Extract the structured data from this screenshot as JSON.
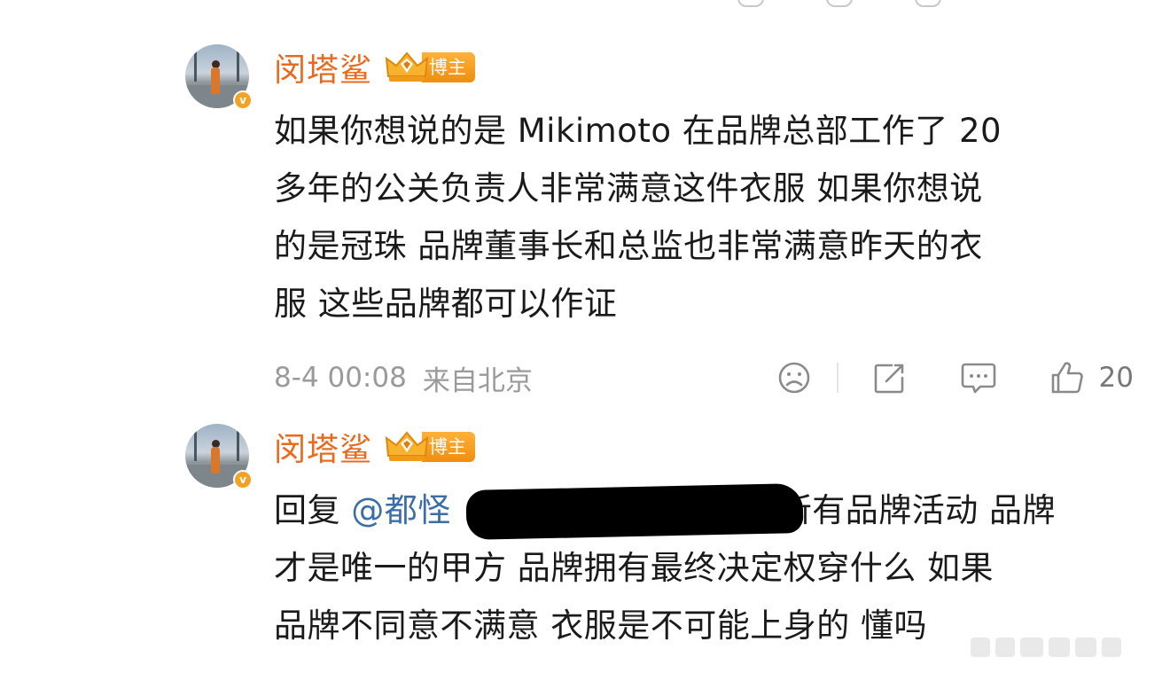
{
  "comments": [
    {
      "username": "闵塔鲨",
      "badge": "博主",
      "body_lines": [
        "如果你想说的是 Mikimoto 在品牌总部工作了 20",
        "多年的公关负责人非常满意这件衣服 如果你想说",
        "的是冠珠 品牌董事长和总监也非常满意昨天的衣",
        "服 这些品牌都可以作证"
      ],
      "timestamp": "8-4 00:08",
      "location": "来自北京",
      "like_count": "20"
    },
    {
      "username": "闵塔鲨",
      "badge": "博主",
      "reply_prefix": "回复",
      "mention": "@都怪",
      "body_line1_tail": "所有品牌活动 品牌",
      "body_lines": [
        "才是唯一的甲方 品牌拥有最终决定权穿什么 如果",
        "品牌不同意不满意 衣服是不可能上身的 懂吗"
      ]
    }
  ],
  "colors": {
    "username": "#e86a1f",
    "badge": "#f39a1c",
    "mention": "#3b6ea8",
    "meta_text": "#9a9a9a"
  },
  "icons": [
    "dislike-icon",
    "repost-icon",
    "comment-icon",
    "like-icon",
    "verified-icon",
    "crown-icon"
  ]
}
